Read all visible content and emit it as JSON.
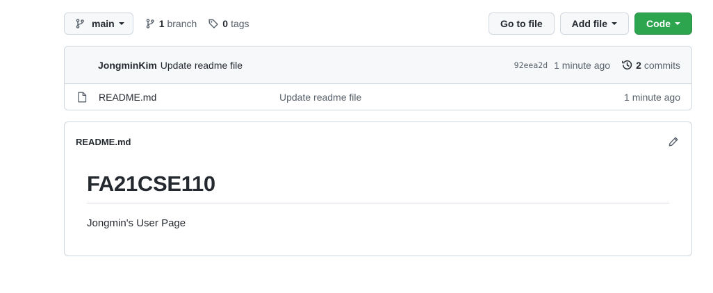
{
  "toolbar": {
    "branch_name": "main",
    "branch_count": "1",
    "branch_label": "branch",
    "tag_count": "0",
    "tag_label": "tags",
    "goto_file_label": "Go to file",
    "add_file_label": "Add file",
    "code_label": "Code"
  },
  "latest_commit": {
    "author": "JongminKim",
    "message": "Update readme file",
    "sha": "92eea2d",
    "time": "1 minute ago",
    "commit_count": "2",
    "commit_label": "commits"
  },
  "files": [
    {
      "icon": "file-icon",
      "name": "README.md",
      "commit_message": "Update readme file",
      "time": "1 minute ago"
    }
  ],
  "readme": {
    "file_name": "README.md",
    "heading": "FA21CSE110",
    "paragraph": "Jongmin's User Page"
  },
  "colors": {
    "primary_button": "#2da44e",
    "border": "#d0d7de",
    "muted_text": "#57606a",
    "text": "#24292f"
  }
}
